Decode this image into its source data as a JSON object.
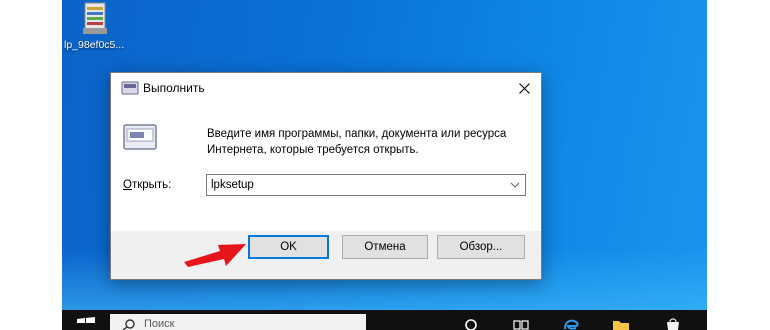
{
  "desktop": {
    "shortcut": {
      "label": "lp_98ef0c5...",
      "icon": "archive-file-icon"
    }
  },
  "run_dialog": {
    "title": "Выполнить",
    "title_icon": "run-icon",
    "close_icon": "close-icon",
    "description": "Введите имя программы, папки, документа или ресурса Интернета, которые требуется открыть.",
    "open_label_accel": "О",
    "open_label_rest": "ткрыть:",
    "command_value": "lpksetup",
    "dropdown_icon": "chevron-down-icon",
    "buttons": {
      "ok": "OK",
      "cancel": "Отмена",
      "browse": "Обзор..."
    },
    "accent_color": "#0078d7"
  },
  "annotation": {
    "arrow_color": "#e8141c",
    "arrow_icon": "red-arrow-pointer"
  },
  "taskbar": {
    "search_placeholder": "Поиск",
    "icons": [
      "windows-start-icon",
      "search-icon",
      "cortana-icon",
      "task-view-icon",
      "edge-icon",
      "file-explorer-icon",
      "store-icon"
    ]
  }
}
